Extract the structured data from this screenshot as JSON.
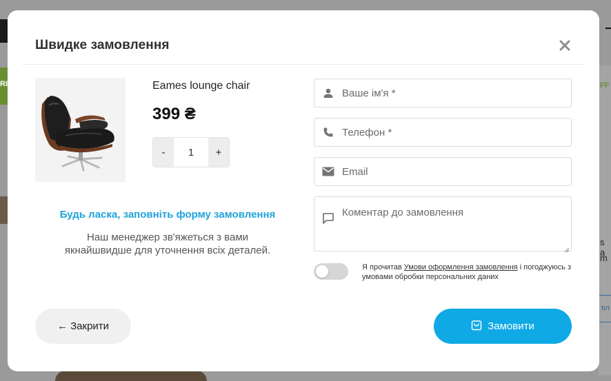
{
  "modal": {
    "title": "Швидке замовлення",
    "close_icon": "close-icon"
  },
  "product": {
    "name": "Eames lounge chair",
    "price": "399 ₴",
    "quantity": "1",
    "qty_minus": "-",
    "qty_plus": "+"
  },
  "info": {
    "prompt": "Будь ласка, заповніть форму замовлення",
    "line1": "Наш менеджер зв'яжеться з вами",
    "line2": "якнайшвидше для уточнення всіх деталей."
  },
  "form": {
    "name_placeholder": "Ваше ім'я *",
    "phone_placeholder": "Телефон *",
    "email_placeholder": "Email",
    "comment_placeholder": "Коментар до замовлення",
    "consent_prefix": "Я прочитав ",
    "consent_link": "Умови оформлення замовлення",
    "consent_suffix": " і погоджуюсь з умовами обробки персональних даних",
    "consent_on": false
  },
  "buttons": {
    "close_label": "← Закрити",
    "order_label": "Замовити"
  },
  "colors": {
    "accent": "#0fa9e6",
    "prompt": "#1fa3da"
  }
}
